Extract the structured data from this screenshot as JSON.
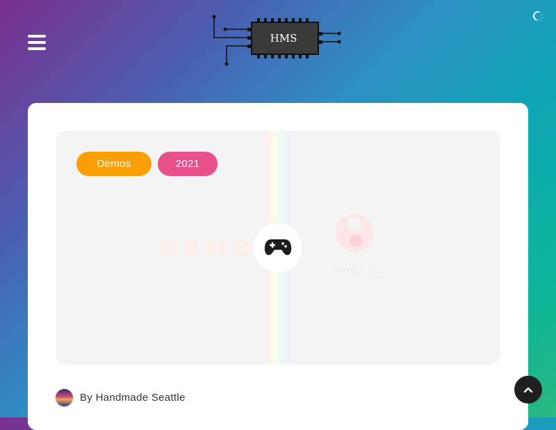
{
  "header": {
    "logo_text": "HMS",
    "menu_icon": "hamburger-menu-icon",
    "loading_icon": "spinner-icon"
  },
  "post": {
    "tags": [
      {
        "label": "Demos",
        "color": "#fb9f07"
      },
      {
        "label": "2021",
        "color": "#e8508a"
      }
    ],
    "image_icons": [
      "demo-wordmark",
      "gamepad-icon",
      "seattle-logo"
    ],
    "author": {
      "byline": "By Handmade Seattle"
    }
  },
  "scroll_top_icon": "chevron-up-icon"
}
